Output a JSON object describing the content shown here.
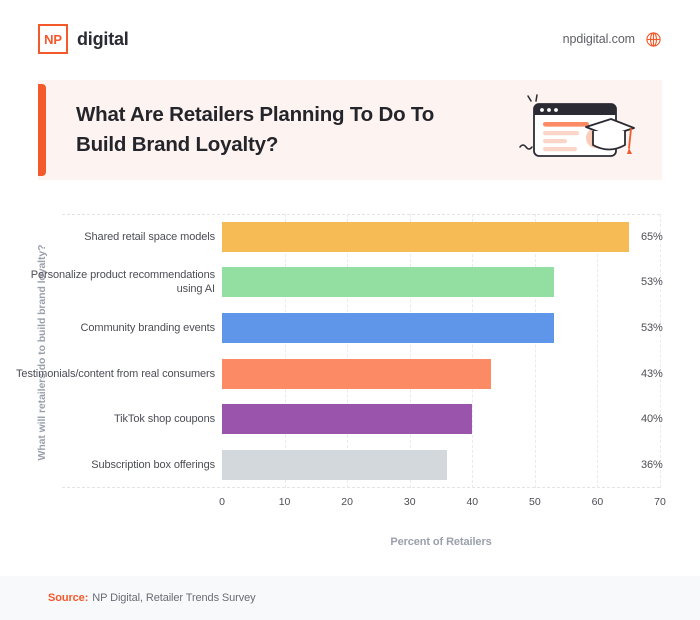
{
  "header": {
    "logo_mark": "NP",
    "logo_word": "digital",
    "site_url": "npdigital.com",
    "globe_icon": "globe-icon",
    "brand_color": "#f4592b"
  },
  "banner": {
    "title": "What Are Retailers Planning To Do To Build Brand Loyalty?",
    "background": "#fdf3f0",
    "accent_color": "#f4592b",
    "illustration": "browser-window-graduation-cap-illustration"
  },
  "chart_data": {
    "type": "bar",
    "orientation": "horizontal",
    "title": "What Are Retailers Planning To Do To Build Brand Loyalty?",
    "categories": [
      "Shared retail space models",
      "Personalize product recommendations using AI",
      "Community branding events",
      "Testimonials/content from real consumers",
      "TikTok shop coupons",
      "Subscription box offerings"
    ],
    "values": [
      65,
      53,
      53,
      43,
      40,
      36
    ],
    "value_labels": [
      "65%",
      "53%",
      "53%",
      "43%",
      "40%",
      "36%"
    ],
    "colors": [
      "#f6bb54",
      "#93dfa1",
      "#6096ea",
      "#fc8a65",
      "#9a54ab",
      "#d3d8dc"
    ],
    "xlabel": "Percent of Retailers",
    "ylabel": "What will retailers do to build brand loyalty?",
    "xlim": [
      0,
      70
    ],
    "xticks": [
      0,
      10,
      20,
      30,
      40,
      50,
      60,
      70
    ],
    "xtick_labels": [
      "0",
      "10",
      "20",
      "30",
      "40",
      "50",
      "60",
      "70"
    ],
    "grid": true,
    "legend": "none"
  },
  "footer": {
    "label": "Source:",
    "text": "NP Digital, Retailer Trends Survey"
  }
}
